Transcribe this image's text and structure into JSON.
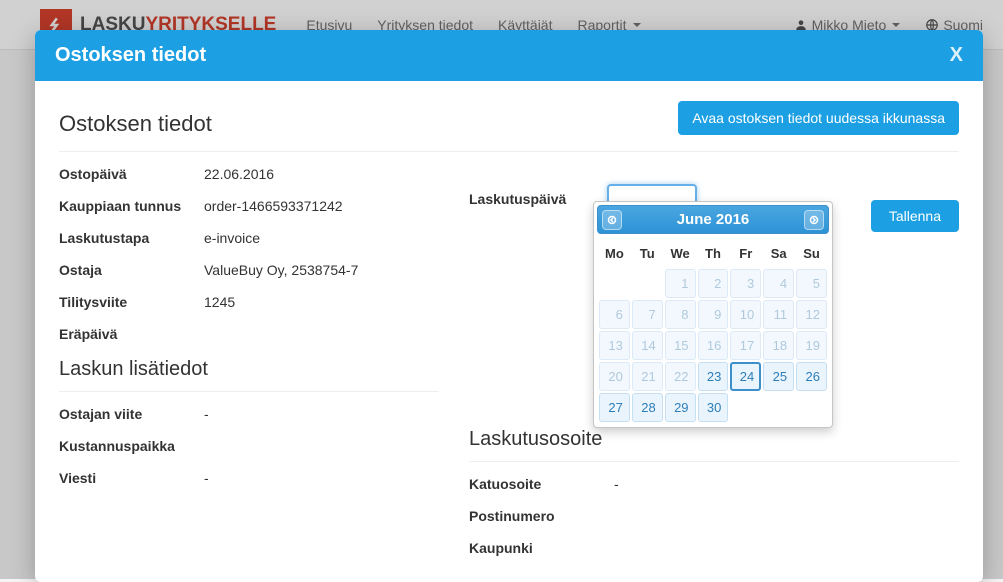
{
  "navbar": {
    "logo_a": "LASKU",
    "logo_b": "YRITYKSELLE",
    "links": [
      "Etusivu",
      "Yrityksen tiedot",
      "Käyttäjät",
      "Raportit"
    ],
    "user": "Mikko Mieto",
    "language": "Suomi"
  },
  "modal": {
    "title": "Ostoksen tiedot",
    "close": "X",
    "open_new_window": "Avaa ostoksen tiedot uudessa ikkunassa",
    "section_title": "Ostoksen tiedot",
    "save": "Tallenna",
    "details": {
      "ostopaiva_label": "Ostopäivä",
      "ostopaiva_value": "22.06.2016",
      "kauppiaan_label": "Kauppiaan tunnus",
      "kauppiaan_value": "order-1466593371242",
      "laskutustapa_label": "Laskutustapa",
      "laskutustapa_value": "e-invoice",
      "ostaja_label": "Ostaja",
      "ostaja_value": "ValueBuy Oy, 2538754-7",
      "tilitysviite_label": "Tilitysviite",
      "tilitysviite_value": "1245",
      "erapaiva_label": "Eräpäivä",
      "erapaiva_value": ""
    },
    "billing": {
      "laskutuspaiva_label": "Laskutuspäivä",
      "laskutuspaiva_value": ""
    },
    "subsections": {
      "lisatiedot_title": "Laskun lisätiedot",
      "ostajan_viite_label": "Ostajan viite",
      "ostajan_viite_value": "-",
      "kustannuspaikka_label": "Kustannuspaikka",
      "kustannuspaikka_value": "",
      "viesti_label": "Viesti",
      "viesti_value": "-",
      "osoite_title": "Laskutusosoite",
      "katuosoite_label": "Katuosoite",
      "katuosoite_value": "-",
      "postinumero_label": "Postinumero",
      "postinumero_value": "",
      "kaupunki_label": "Kaupunki",
      "kaupunki_value": ""
    }
  },
  "datepicker": {
    "month_year": "June  2016",
    "dow": [
      "Mo",
      "Tu",
      "We",
      "Th",
      "Fr",
      "Sa",
      "Su"
    ],
    "weeks": [
      [
        null,
        null,
        {
          "n": 1,
          "s": "disabled"
        },
        {
          "n": 2,
          "s": "disabled"
        },
        {
          "n": 3,
          "s": "disabled"
        },
        {
          "n": 4,
          "s": "disabled"
        },
        {
          "n": 5,
          "s": "disabled"
        }
      ],
      [
        {
          "n": 6,
          "s": "disabled"
        },
        {
          "n": 7,
          "s": "disabled"
        },
        {
          "n": 8,
          "s": "disabled"
        },
        {
          "n": 9,
          "s": "disabled"
        },
        {
          "n": 10,
          "s": "disabled"
        },
        {
          "n": 11,
          "s": "disabled"
        },
        {
          "n": 12,
          "s": "disabled"
        }
      ],
      [
        {
          "n": 13,
          "s": "disabled"
        },
        {
          "n": 14,
          "s": "disabled"
        },
        {
          "n": 15,
          "s": "disabled"
        },
        {
          "n": 16,
          "s": "disabled"
        },
        {
          "n": 17,
          "s": "disabled"
        },
        {
          "n": 18,
          "s": "disabled"
        },
        {
          "n": 19,
          "s": "disabled"
        }
      ],
      [
        {
          "n": 20,
          "s": "disabled"
        },
        {
          "n": 21,
          "s": "disabled"
        },
        {
          "n": 22,
          "s": "disabled"
        },
        {
          "n": 23,
          "s": ""
        },
        {
          "n": 24,
          "s": "highlight"
        },
        {
          "n": 25,
          "s": ""
        },
        {
          "n": 26,
          "s": ""
        }
      ],
      [
        {
          "n": 27,
          "s": ""
        },
        {
          "n": 28,
          "s": ""
        },
        {
          "n": 29,
          "s": ""
        },
        {
          "n": 30,
          "s": ""
        },
        null,
        null,
        null
      ]
    ]
  }
}
